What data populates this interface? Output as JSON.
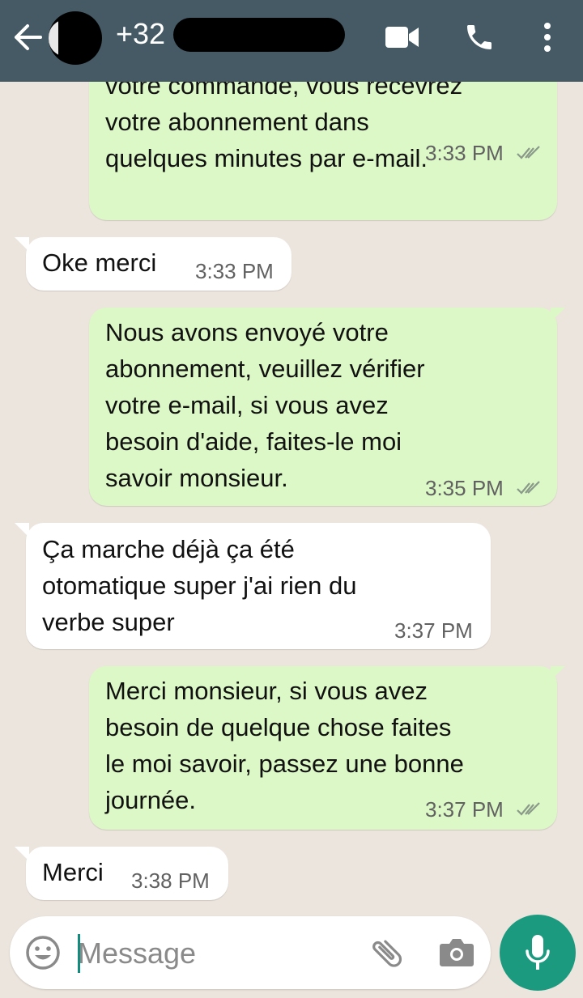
{
  "header": {
    "contact_name": "+32"
  },
  "messages": [
    {
      "direction": "out",
      "text": "votre commande,  vous recevrez\nvotre abonnement dans\nquelques minutes par e-mail.",
      "time": "3:33 PM",
      "status": "read"
    },
    {
      "direction": "in",
      "text": "Oke merci",
      "time": "3:33 PM"
    },
    {
      "direction": "out",
      "text": "Nous avons envoyé votre\nabonnement,  veuillez vérifier\nvotre e-mail,  si vous avez\nbesoin d'aide,  faites-le moi\nsavoir monsieur.",
      "time": "3:35 PM",
      "status": "read"
    },
    {
      "direction": "in",
      "text": "Ça marche déjà ça été\notomatique super j'ai rien du\nverbe super",
      "time": "3:37 PM"
    },
    {
      "direction": "out",
      "text": "Merci monsieur,  si vous avez\nbesoin de quelque chose faites\nle moi savoir,  passez une bonne\njournée.",
      "time": "3:37 PM",
      "status": "read"
    },
    {
      "direction": "in",
      "text": "Merci",
      "time": "3:38 PM"
    }
  ],
  "input": {
    "placeholder": "Message"
  },
  "colors": {
    "header": "#455a64",
    "outgoing_bubble": "#dcf8c6",
    "incoming_bubble": "#ffffff",
    "chat_background": "#ece5dd",
    "mic_button": "#1c9a7f"
  },
  "icons": [
    "back-arrow-icon",
    "video-call-icon",
    "phone-icon",
    "more-vert-icon",
    "emoji-icon",
    "attach-icon",
    "camera-icon",
    "mic-icon",
    "double-check-icon"
  ]
}
